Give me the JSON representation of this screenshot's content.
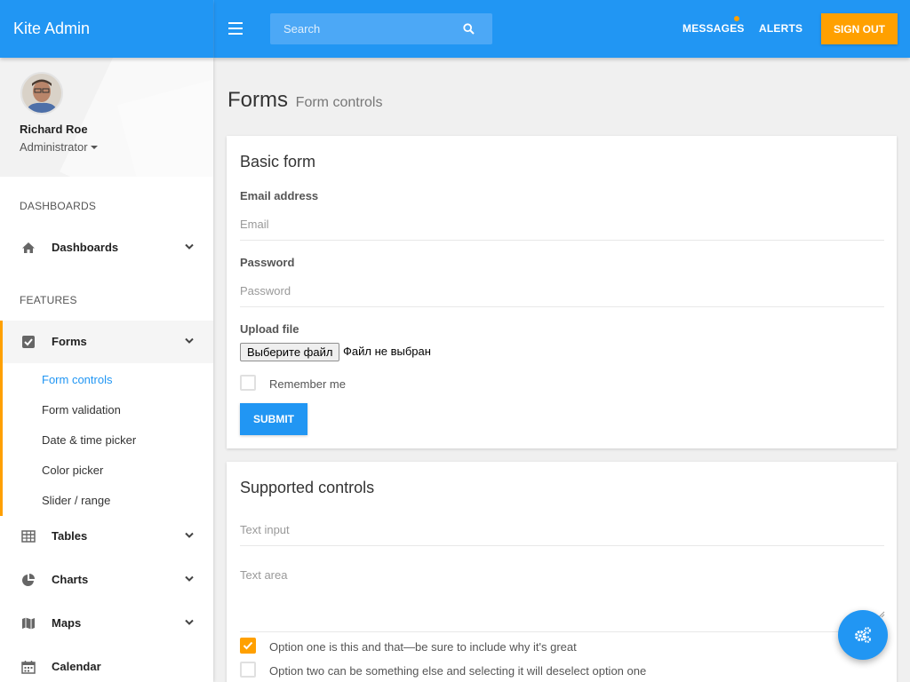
{
  "app": {
    "title": "Kite Admin"
  },
  "header": {
    "search_placeholder": "Search",
    "messages": "MESSAGES",
    "alerts": "ALERTS",
    "sign_out": "SIGN OUT"
  },
  "user": {
    "name": "Richard Roe",
    "role": "Administrator"
  },
  "sidebar": {
    "sections": [
      "DASHBOARDS",
      "FEATURES"
    ],
    "dashboards": "Dashboards",
    "forms": "Forms",
    "forms_subitems": [
      "Form controls",
      "Form validation",
      "Date & time picker",
      "Color picker",
      "Slider / range"
    ],
    "tables": "Tables",
    "charts": "Charts",
    "maps": "Maps",
    "calendar": "Calendar"
  },
  "page": {
    "title": "Forms",
    "subtitle": "Form controls"
  },
  "basic_form": {
    "title": "Basic form",
    "email_label": "Email address",
    "email_placeholder": "Email",
    "password_label": "Password",
    "password_placeholder": "Password",
    "upload_label": "Upload file",
    "file_button": "Выберите файл",
    "file_status": "Файл не выбран",
    "remember_me": "Remember me",
    "submit": "SUBMIT"
  },
  "supported_controls": {
    "title": "Supported controls",
    "text_input_placeholder": "Text input",
    "text_area_placeholder": "Text area",
    "option_one": "Option one is this and that—be sure to include why it's great",
    "option_two": "Option two can be something else and selecting it will deselect option one"
  },
  "colors": {
    "primary": "#2196f3",
    "accent": "#ffa000"
  }
}
